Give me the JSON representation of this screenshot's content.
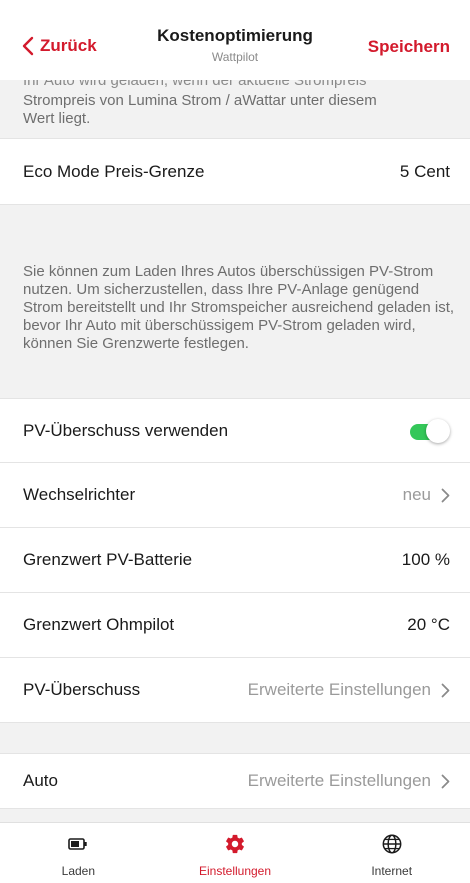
{
  "header": {
    "back_label": "Zurück",
    "title": "Kostenoptimierung",
    "subtitle": "Wattpilot",
    "save_label": "Speichern"
  },
  "top_info": {
    "clipped_line": "Ihr Auto wird geladen, wenn der aktuelle Strompreis",
    "line1": "Strompreis von Lumina Strom / aWattar unter diesem",
    "line2": "Wert liegt."
  },
  "eco_mode": {
    "label": "Eco Mode Preis-Grenze",
    "value": "5 Cent"
  },
  "pv_info": {
    "text": "Sie können zum Laden Ihres Autos überschüssigen PV-Strom nutzen. Um sicherzustellen, dass Ihre PV-Anlage genügend Strom bereitstellt und Ihr Stromspeicher ausreichend geladen ist, bevor Ihr Auto mit überschüssigem PV-Strom geladen wird, können Sie Grenzwerte festlegen."
  },
  "pv_surplus_toggle": {
    "label": "PV-Überschuss verwenden",
    "enabled": true,
    "color": "#34c759"
  },
  "inverter": {
    "label": "Wechselrichter",
    "value": "neu"
  },
  "battery_threshold": {
    "label": "Grenzwert PV-Batterie",
    "value": "100 %"
  },
  "ohmpilot_threshold": {
    "label": "Grenzwert Ohmpilot",
    "value": "20 °C"
  },
  "pv_surplus": {
    "label": "PV-Überschuss",
    "value": "Erweiterte Einstellungen"
  },
  "car": {
    "label": "Auto",
    "value": "Erweiterte Einstellungen"
  },
  "tabbar": {
    "tabs": [
      {
        "label": "Laden",
        "icon": "battery-icon"
      },
      {
        "label": "Einstellungen",
        "icon": "gear-icon",
        "active": true
      },
      {
        "label": "Internet",
        "icon": "globe-icon"
      }
    ]
  },
  "colors": {
    "accent": "#d31a2c",
    "toggle_on": "#34c759",
    "background": "#f2f2f2"
  }
}
